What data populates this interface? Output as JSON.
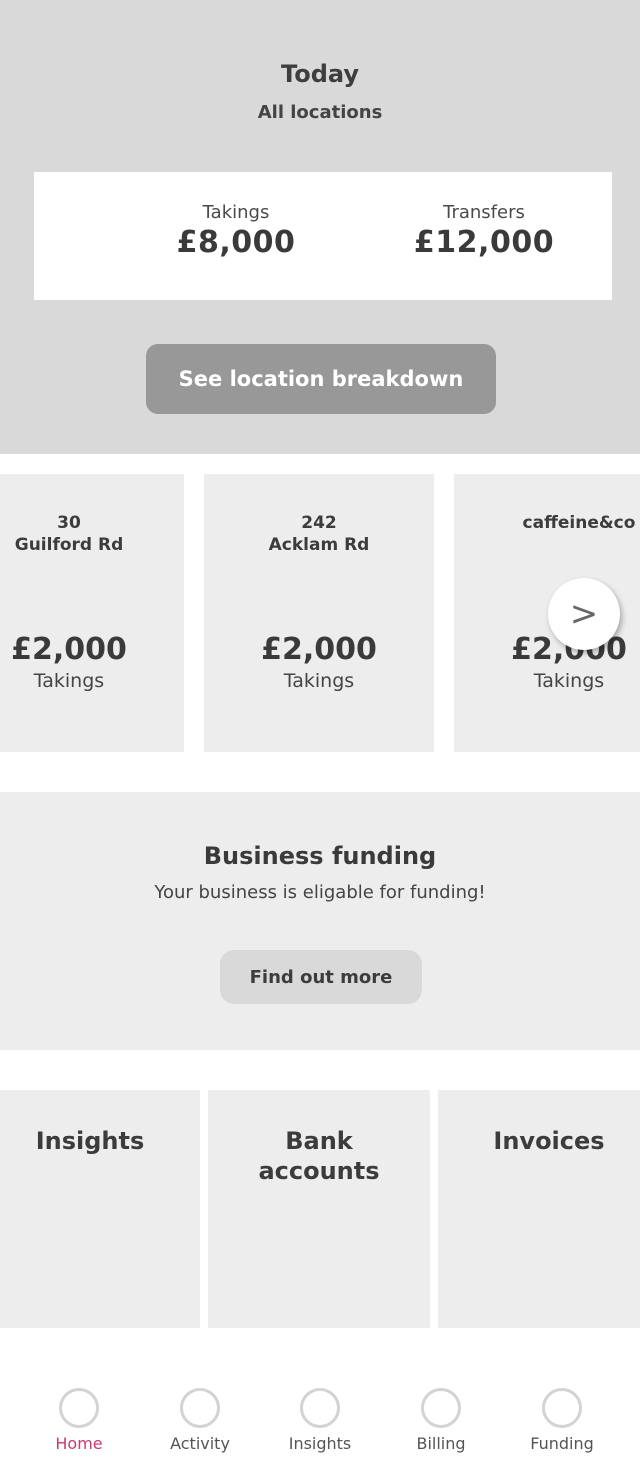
{
  "summary": {
    "title": "Today",
    "subtitle": "All locations",
    "takings_label": "Takings",
    "takings_value": "£8,000",
    "transfers_label": "Transfers",
    "transfers_value": "£12,000",
    "breakdown_button": "See location breakdown"
  },
  "locations": [
    {
      "name": "30\nGuilford Rd",
      "amount": "£2,000",
      "label": "Takings"
    },
    {
      "name": "242\nAcklam Rd",
      "amount": "£2,000",
      "label": "Takings"
    },
    {
      "name": "caffeine&co",
      "amount": "£2,000",
      "label": "Takings"
    }
  ],
  "carousel": {
    "next_glyph": ">"
  },
  "funding": {
    "title": "Business funding",
    "text": "Your business is eligable for funding!",
    "button": "Find out more"
  },
  "tiles": [
    {
      "label": "Insights"
    },
    {
      "label": "Bank\naccounts"
    },
    {
      "label": "Invoices"
    }
  ],
  "tabs": [
    {
      "label": "Home",
      "active": true
    },
    {
      "label": "Activity"
    },
    {
      "label": "Insights"
    },
    {
      "label": "Billing"
    },
    {
      "label": "Funding"
    }
  ],
  "colors": {
    "accent": "#c83a73",
    "header_bg": "#d9d9d9",
    "card_bg": "#ededed",
    "button_bg": "#989898"
  }
}
